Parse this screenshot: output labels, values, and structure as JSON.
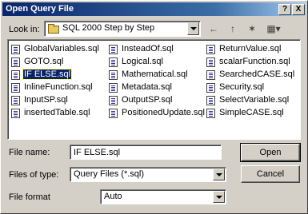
{
  "window": {
    "title": "Open Query File",
    "help_label": "?",
    "close_label": "X"
  },
  "look_in": {
    "label": "Look in:",
    "value": "SQL 2000 Step by Step"
  },
  "toolbar": {
    "back_icon": "←",
    "up_icon": "↑",
    "newfolder_icon": "✶",
    "views_icon": "▦▾"
  },
  "files": {
    "col1": [
      "GlobalVariables.sql",
      "GOTO.sql",
      "IF ELSE.sql",
      "InlineFunction.sql",
      "InputSP.sql",
      "insertedTable.sql"
    ],
    "col2": [
      "InsteadOf.sql",
      "Logical.sql",
      "Mathematical.sql",
      "Metadata.sql",
      "OutputSP.sql",
      "PositionedUpdate.sql"
    ],
    "col3": [
      "ReturnValue.sql",
      "scalarFunction.sql",
      "SearchedCASE.sql",
      "Security.sql",
      "SelectVariable.sql",
      "SimpleCASE.sql"
    ],
    "selected": "IF ELSE.sql"
  },
  "file_name": {
    "label": "File name:",
    "value": "IF ELSE.sql"
  },
  "files_of_type": {
    "label": "Files of type:",
    "value": "Query Files (*.sql)"
  },
  "file_format": {
    "label": "File format",
    "value": "Auto"
  },
  "buttons": {
    "open": "Open",
    "cancel": "Cancel"
  }
}
